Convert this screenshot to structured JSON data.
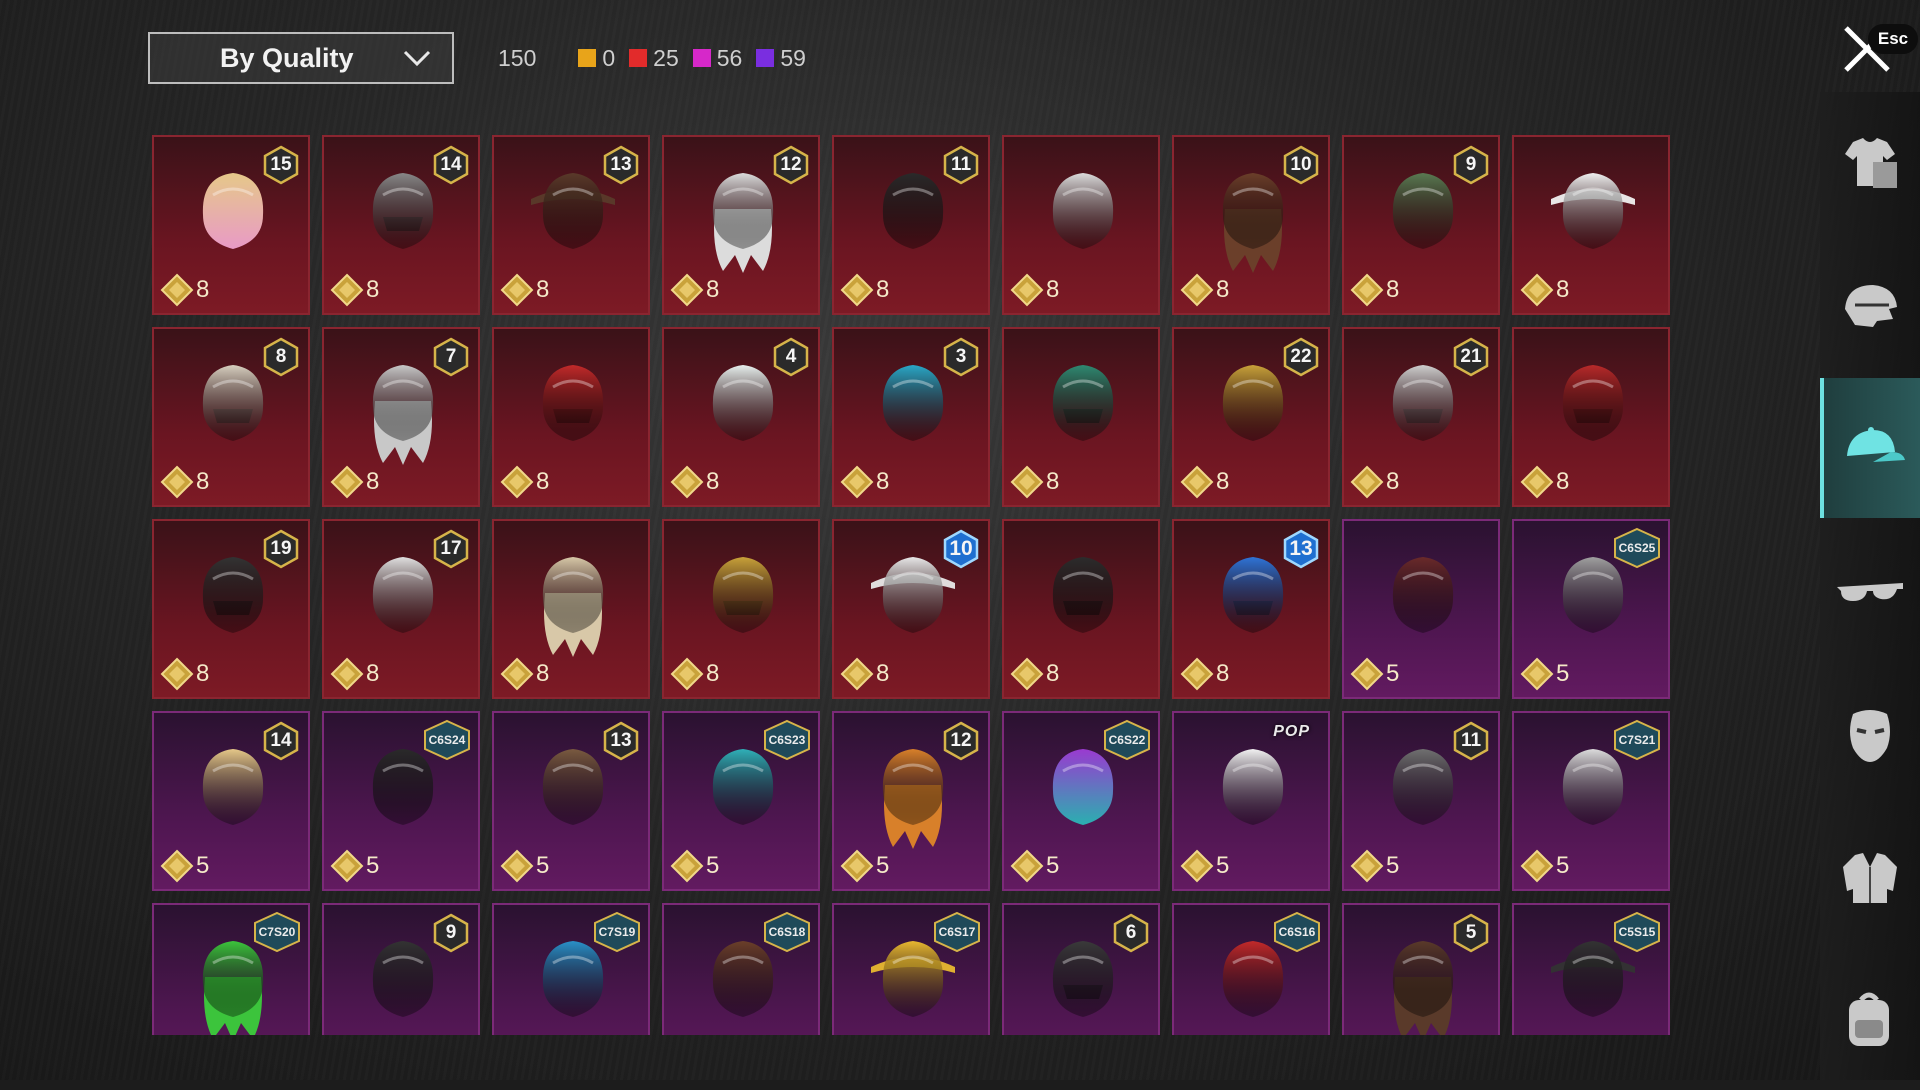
{
  "sort": {
    "label": "By Quality"
  },
  "total_count": "150",
  "quality_counts": [
    {
      "color": "#e8a41a",
      "count": "0"
    },
    {
      "color": "#e22b2b",
      "count": "25"
    },
    {
      "color": "#d628c9",
      "count": "56"
    },
    {
      "color": "#7a2ee0",
      "count": "59"
    }
  ],
  "close": {
    "icon": "close-icon",
    "key_label": "Esc"
  },
  "sidebar": [
    {
      "name": "outfit",
      "icon": "outfit-icon"
    },
    {
      "name": "headgear",
      "icon": "helmet-icon"
    },
    {
      "name": "hats",
      "icon": "cap-icon",
      "active": true
    },
    {
      "name": "eyewear",
      "icon": "glasses-icon"
    },
    {
      "name": "masks",
      "icon": "mask-icon"
    },
    {
      "name": "jackets",
      "icon": "jacket-icon"
    },
    {
      "name": "backpacks",
      "icon": "backpack-icon"
    }
  ],
  "items": [
    {
      "rarity": "red",
      "badge": "15",
      "price": "8",
      "icon": "blonde-pink-hair-icon"
    },
    {
      "rarity": "red",
      "badge": "14",
      "price": "8",
      "icon": "cat-ear-mask-icon"
    },
    {
      "rarity": "red",
      "badge": "13",
      "price": "8",
      "icon": "hat-with-hair-icon"
    },
    {
      "rarity": "red",
      "badge": "12",
      "price": "8",
      "icon": "white-long-hair-icon"
    },
    {
      "rarity": "red",
      "badge": "11",
      "price": "8",
      "icon": "black-hair-icon"
    },
    {
      "rarity": "red",
      "badge": "",
      "price": "8",
      "icon": "white-hair-horns-icon"
    },
    {
      "rarity": "red",
      "badge": "10",
      "price": "8",
      "icon": "brown-long-hair-icon"
    },
    {
      "rarity": "red",
      "badge": "9",
      "price": "8",
      "icon": "zombie-head-icon"
    },
    {
      "rarity": "red",
      "badge": "",
      "price": "8",
      "icon": "cowboy-hat-icon"
    },
    {
      "rarity": "red",
      "badge": "8",
      "price": "8",
      "icon": "winged-helmet-icon"
    },
    {
      "rarity": "red",
      "badge": "7",
      "price": "8",
      "icon": "silver-long-hair-icon"
    },
    {
      "rarity": "red",
      "badge": "",
      "price": "8",
      "icon": "red-helmet-icon"
    },
    {
      "rarity": "red",
      "badge": "4",
      "price": "8",
      "icon": "snowman-head-icon"
    },
    {
      "rarity": "red",
      "badge": "3",
      "price": "8",
      "icon": "joker-head-icon"
    },
    {
      "rarity": "red",
      "badge": "",
      "price": "8",
      "icon": "jade-helmet-icon"
    },
    {
      "rarity": "red",
      "badge": "22",
      "price": "8",
      "icon": "golden-headdress-icon"
    },
    {
      "rarity": "red",
      "badge": "21",
      "price": "8",
      "icon": "clown-mask-icon"
    },
    {
      "rarity": "red",
      "badge": "",
      "price": "8",
      "icon": "demon-mask-icon"
    },
    {
      "rarity": "red",
      "badge": "19",
      "price": "8",
      "icon": "dark-helmet-icon"
    },
    {
      "rarity": "red",
      "badge": "17",
      "price": "8",
      "icon": "spiky-white-hair-icon"
    },
    {
      "rarity": "red",
      "badge": "",
      "price": "8",
      "icon": "veil-hood-icon"
    },
    {
      "rarity": "red",
      "badge": "",
      "price": "8",
      "icon": "gold-red-helmet-icon"
    },
    {
      "rarity": "red",
      "badge": "10",
      "badge_style": "blue",
      "price": "8",
      "icon": "chef-hat-hair-icon"
    },
    {
      "rarity": "red",
      "badge": "",
      "price": "8",
      "icon": "horned-helmet-icon"
    },
    {
      "rarity": "red",
      "badge": "13",
      "badge_style": "blue",
      "price": "8",
      "icon": "robot-helmet-icon"
    },
    {
      "rarity": "purple",
      "badge": "",
      "price": "5",
      "icon": "maroon-hair-icon"
    },
    {
      "rarity": "purple",
      "code": "C6S25",
      "price": "5",
      "icon": "grey-bun-hair-icon"
    },
    {
      "rarity": "purple",
      "badge": "14",
      "price": "5",
      "icon": "blonde-flower-hair-icon"
    },
    {
      "rarity": "purple",
      "code": "C6S24",
      "price": "5",
      "icon": "black-bob-hair-icon"
    },
    {
      "rarity": "purple",
      "badge": "13",
      "price": "5",
      "icon": "goggles-hair-icon"
    },
    {
      "rarity": "purple",
      "code": "C6S23",
      "price": "5",
      "icon": "headphones-hair-icon"
    },
    {
      "rarity": "purple",
      "badge": "12",
      "price": "5",
      "icon": "orange-long-hair-icon"
    },
    {
      "rarity": "purple",
      "code": "C6S22",
      "price": "5",
      "icon": "purple-teal-hair-icon"
    },
    {
      "rarity": "purple",
      "tag": "POP",
      "price": "5",
      "icon": "panda-head-icon"
    },
    {
      "rarity": "purple",
      "badge": "11",
      "price": "5",
      "icon": "flower-crown-hair-icon"
    },
    {
      "rarity": "purple",
      "code": "C7S21",
      "price": "5",
      "icon": "white-slick-hair-icon"
    },
    {
      "rarity": "purple",
      "code": "C7S20",
      "price": "",
      "icon": "green-pigtails-icon"
    },
    {
      "rarity": "purple",
      "badge": "9",
      "price": "",
      "icon": "dark-brown-hair-icon"
    },
    {
      "rarity": "purple",
      "code": "C7S19",
      "price": "",
      "icon": "feather-headdress-icon"
    },
    {
      "rarity": "purple",
      "code": "C6S18",
      "price": "",
      "icon": "brown-bob-hair-icon"
    },
    {
      "rarity": "purple",
      "code": "C6S17",
      "price": "",
      "icon": "visor-cap-icon"
    },
    {
      "rarity": "purple",
      "badge": "6",
      "price": "",
      "icon": "knight-helmet-icon"
    },
    {
      "rarity": "purple",
      "code": "C6S16",
      "price": "",
      "icon": "red-hood-icon"
    },
    {
      "rarity": "purple",
      "badge": "5",
      "price": "",
      "icon": "bow-pigtails-icon"
    },
    {
      "rarity": "purple",
      "code": "C5S15",
      "price": "",
      "icon": "dark-cap-icon"
    }
  ]
}
